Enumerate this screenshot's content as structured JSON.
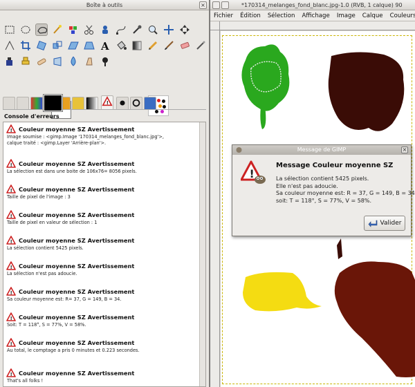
{
  "toolbox": {
    "title": "Boîte à outils",
    "console_title": "Console d'erreurs"
  },
  "console_entries": [
    {
      "title": "Couleur moyenne SZ Avertissement",
      "body": "Image soumise : <gimp.Image '170314_melanges_fond_blanc.jpg'>,\ncalque traité : <gimp.Layer 'Arrière-plan'>."
    },
    {
      "title": "Couleur moyenne SZ Avertissement",
      "body": "La sélection est dans une boite de 106x76= 8056 pixels."
    },
    {
      "title": "Couleur moyenne SZ Avertissement",
      "body": "Taille de pixel de l'image : 3"
    },
    {
      "title": "Couleur moyenne SZ Avertissement",
      "body": "Taille de pixel en valeur de sélection : 1"
    },
    {
      "title": "Couleur moyenne SZ Avertissement",
      "body": "La sélection contient 5425 pixels."
    },
    {
      "title": "Couleur moyenne SZ Avertissement",
      "body": "La sélection n'est pas adoucie."
    },
    {
      "title": "Couleur moyenne SZ Avertissement",
      "body": "Sa couleur moyenne est: R= 37, G = 149, B = 34."
    },
    {
      "title": "Couleur moyenne SZ Avertissement",
      "body": "Soit: T = 118°, S = 77%, V = 58%."
    },
    {
      "title": "Couleur moyenne SZ Avertissement",
      "body": "Au total, le comptage a pris 0 minutes et 0.223 secondes."
    },
    {
      "title": "Couleur moyenne SZ Avertissement",
      "body": "That's all folks !"
    }
  ],
  "image_window": {
    "title": "*170314_melanges_fond_blanc.jpg-1.0 (RVB, 1 calque) 90",
    "menu": [
      "Fichier",
      "Édition",
      "Sélection",
      "Affichage",
      "Image",
      "Calque",
      "Couleurs"
    ]
  },
  "dialog": {
    "title": "Message de GIMP",
    "heading": "Message Couleur moyenne SZ",
    "body": "La sélection contient 5425 pixels.\nElle n'est pas adoucie.\nSa couleur moyenne est: R = 37, G = 149, B = 34,\nsoit: T = 118°, S = 77%, V = 58%.",
    "button": "Valider"
  },
  "colors": {
    "foreground": "#000000",
    "background": "#ffffff",
    "green_blob": "#2aa81e",
    "dark_blob": "#3a0c06",
    "yellow_blob": "#f4dc12",
    "brown_blob": "#6a1608"
  },
  "icons": {
    "warning": "warning-triangle-icon",
    "dialog_ok": "ok-arrow-icon"
  }
}
